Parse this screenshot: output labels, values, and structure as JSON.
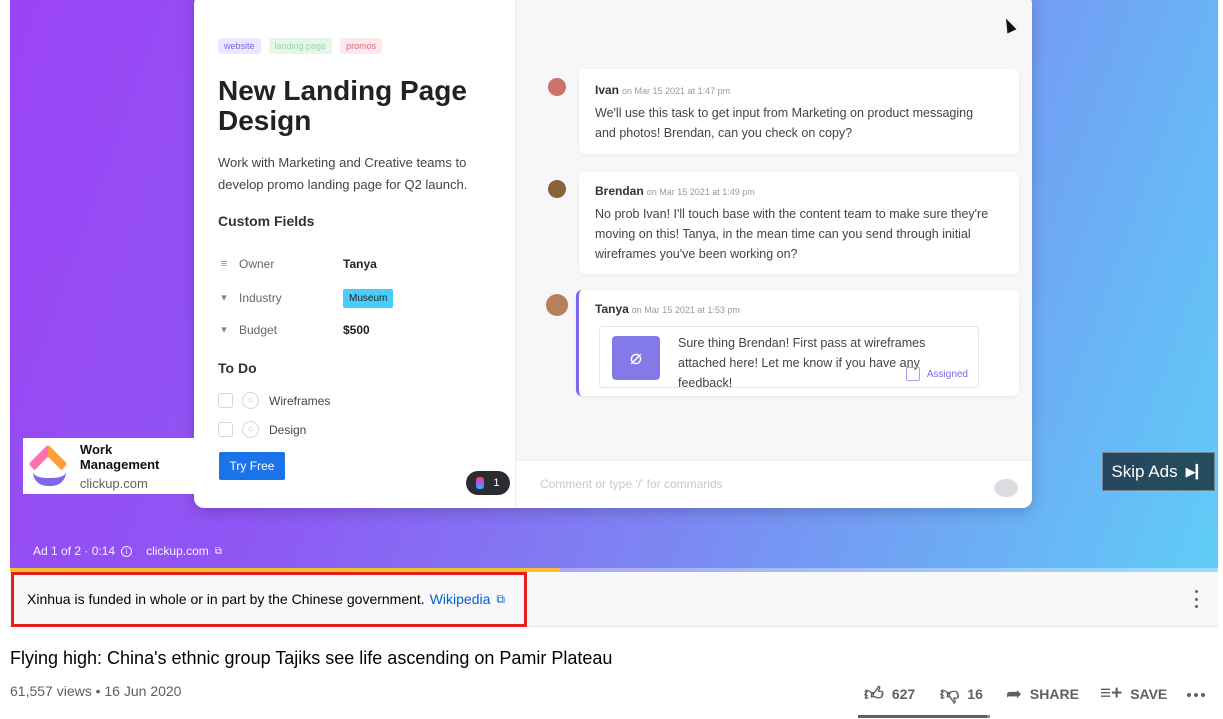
{
  "ad_video": {
    "tags": [
      "website",
      "landing page",
      "promos"
    ],
    "task_title": "New Landing Page Design",
    "task_description": "Work with Marketing and Creative teams to develop promo landing page for Q2 launch.",
    "custom_fields_heading": "Custom Fields",
    "fields": [
      {
        "name": "Owner",
        "value": "Tanya"
      },
      {
        "name": "Industry",
        "value": "Museum"
      },
      {
        "name": "Budget",
        "value": "$500"
      }
    ],
    "todo_heading": "To Do",
    "todos": [
      "Wireframes",
      "Design"
    ],
    "figma_count": "1",
    "comments": [
      {
        "name": "Ivan",
        "date": "on Mar 15 2021 at 1:47 pm",
        "text": "We'll use this task to get input from Marketing on product messaging and photos! Brendan, can you check on copy?"
      },
      {
        "name": "Brendan",
        "date": "on Mar 15 2021 at 1:49 pm",
        "text": "No prob Ivan! I'll touch base with the content team to make sure they're moving on this! Tanya, in the mean time can you send through initial wireframes you've been working on?"
      },
      {
        "name": "Tanya",
        "date": "on Mar 15 2021 at 1:53 pm",
        "text": "Sure thing Brendan! First pass at wireframes attached here! Let me know if you have any feedback!",
        "assigned_label": "Assigned"
      }
    ],
    "comment_placeholder": "Comment or type '/' for commands"
  },
  "ad_overlay": {
    "advertiser_title": "Work Management",
    "advertiser_domain": "clickup.com",
    "cta_label": "Try Free",
    "skip_label": "Skip Ads",
    "ad_position": "Ad 1 of 2 · 0:14",
    "ad_domain_link": "clickup.com",
    "progress_fraction": 0.455
  },
  "info_panel": {
    "text": "Xinhua is funded in whole or in part by the Chinese government.",
    "link_label": "Wikipedia"
  },
  "video": {
    "title": "Flying high: China's ethnic group Tajiks see life ascending on Pamir Plateau",
    "meta": "61,557 views • 16 Jun 2020",
    "likes": "627",
    "dislikes": "16",
    "like_fraction": 0.975,
    "share_label": "SHARE",
    "save_label": "SAVE"
  },
  "icons": [
    "thumb-up-icon",
    "thumb-down-icon",
    "share-icon",
    "playlist-add-icon",
    "more-icon",
    "external-link-icon",
    "info-icon",
    "skip-next-icon",
    "paperclip-icon"
  ],
  "colors": {
    "link": "#065fd4",
    "highlight_border": "#e52020",
    "ad_progress": "#fbc02d",
    "cta": "#1a73e8"
  }
}
